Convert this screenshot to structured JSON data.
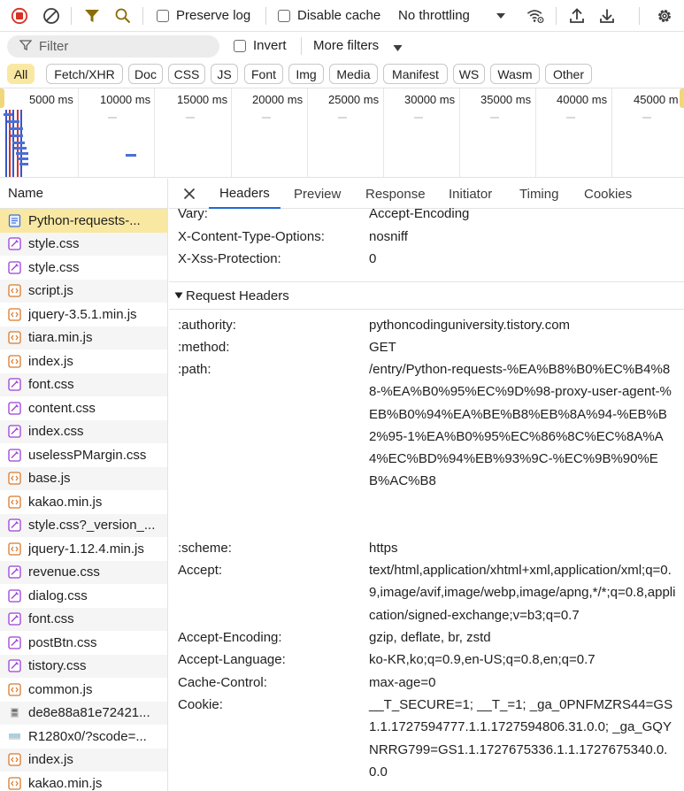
{
  "toolbar": {
    "record_icon": "record-stop-icon",
    "clear_icon": "clear-icon",
    "filter_icon": "filter-funnel-icon",
    "search_icon": "search-icon",
    "preserve_log": "Preserve log",
    "disable_cache": "Disable cache",
    "throttling": "No throttling",
    "network_conditions_icon": "wifi-settings-icon",
    "import_icon": "upload-icon",
    "export_icon": "download-icon",
    "settings_icon": "gear-icon",
    "accent_color": "#d93025"
  },
  "filterbar": {
    "placeholder": "Filter",
    "invert": "Invert",
    "more_filters": "More filters"
  },
  "chips": [
    "All",
    "Fetch/XHR",
    "Doc",
    "CSS",
    "JS",
    "Font",
    "Img",
    "Media",
    "Manifest",
    "WS",
    "Wasm",
    "Other"
  ],
  "timeline": {
    "ticks": [
      "5000 ms",
      "10000 ms",
      "15000 ms",
      "20000 ms",
      "25000 ms",
      "30000 ms",
      "35000 ms",
      "40000 ms",
      "45000 m"
    ]
  },
  "list": {
    "header": "Name",
    "items": [
      {
        "name": "Python-requests-...",
        "type": "doc"
      },
      {
        "name": "style.css",
        "type": "css"
      },
      {
        "name": "style.css",
        "type": "css"
      },
      {
        "name": "script.js",
        "type": "js"
      },
      {
        "name": "jquery-3.5.1.min.js",
        "type": "js"
      },
      {
        "name": "tiara.min.js",
        "type": "js"
      },
      {
        "name": "index.js",
        "type": "js"
      },
      {
        "name": "font.css",
        "type": "css"
      },
      {
        "name": "content.css",
        "type": "css"
      },
      {
        "name": "index.css",
        "type": "css"
      },
      {
        "name": "uselessPMargin.css",
        "type": "css"
      },
      {
        "name": "base.js",
        "type": "js"
      },
      {
        "name": "kakao.min.js",
        "type": "js"
      },
      {
        "name": "style.css?_version_...",
        "type": "css"
      },
      {
        "name": "jquery-1.12.4.min.js",
        "type": "js"
      },
      {
        "name": "revenue.css",
        "type": "css"
      },
      {
        "name": "dialog.css",
        "type": "css"
      },
      {
        "name": "font.css",
        "type": "css"
      },
      {
        "name": "postBtn.css",
        "type": "css"
      },
      {
        "name": "tistory.css",
        "type": "css"
      },
      {
        "name": "common.js",
        "type": "js"
      },
      {
        "name": "de8e88a81e72421...",
        "type": "img"
      },
      {
        "name": "R1280x0/?scode=...",
        "type": "img2"
      },
      {
        "name": "index.js",
        "type": "js"
      },
      {
        "name": "kakao.min.js",
        "type": "js"
      }
    ]
  },
  "tabs": [
    "Headers",
    "Preview",
    "Response",
    "Initiator",
    "Timing",
    "Cookies"
  ],
  "response_headers_tail": [
    {
      "key": "Vary:",
      "value": "Accept-Encoding"
    },
    {
      "key": "X-Content-Type-Options:",
      "value": "nosniff"
    },
    {
      "key": "X-Xss-Protection:",
      "value": "0"
    }
  ],
  "request_section": "Request Headers",
  "request_headers": [
    {
      "key": ":authority:",
      "value": "pythoncodinguniversity.tistory.com"
    },
    {
      "key": ":method:",
      "value": "GET"
    },
    {
      "key": ":path:",
      "value": "/entry/Python-requests-%EA%B8%B0%EC%B4%88-%EA%B0%95%EC%9D%98-proxy-user-agent-%EB%B0%94%EA%BE%B8%EB%8A%94-%EB%B2%95-1%EA%B0%95%EC%86%8C%EC%8A%A4%EC%BD%94%EB%93%9C-%EC%9B%90%EB%AC%B8"
    },
    {
      "key": ":scheme:",
      "value": "https"
    },
    {
      "key": "Accept:",
      "value": "text/html,application/xhtml+xml,application/xml;q=0.9,image/avif,image/webp,image/apng,*/*;q=0.8,application/signed-exchange;v=b3;q=0.7"
    },
    {
      "key": "Accept-Encoding:",
      "value": "gzip, deflate, br, zstd"
    },
    {
      "key": "Accept-Language:",
      "value": "ko-KR,ko;q=0.9,en-US;q=0.8,en;q=0.7"
    },
    {
      "key": "Cache-Control:",
      "value": "max-age=0"
    },
    {
      "key": "Cookie:",
      "value": "__T_SECURE=1; __T_=1; _ga_0PNFMZRS44=GS1.1.1727594777.1.1.1727594806.31.0.0; _ga_GQYNRRG799=GS1.1.1727675336.1.1.1727675340.0.0.0"
    }
  ]
}
